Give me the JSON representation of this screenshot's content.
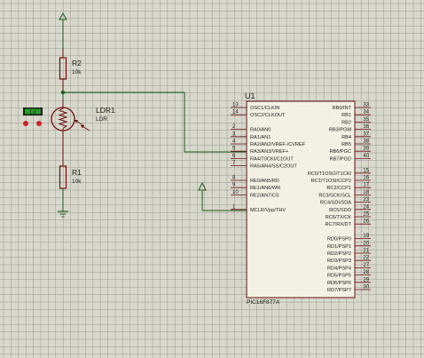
{
  "schematic": {
    "r2": {
      "ref": "R2",
      "value": "10k"
    },
    "r1": {
      "ref": "R1",
      "value": "10k"
    },
    "ldr": {
      "ref": "LDR1",
      "value": "LDR",
      "reading": "1.0"
    },
    "mcu": {
      "ref": "U1",
      "part": "PIC16F877A",
      "left_pins": [
        {
          "num": "13",
          "name": "OSC1/CLKIN"
        },
        {
          "num": "14",
          "name": "OSC2/CLKOUT"
        },
        {
          "num": "2",
          "name": "RA0/AN0"
        },
        {
          "num": "3",
          "name": "RA1/AN1"
        },
        {
          "num": "4",
          "name": "RA2/AN2/VREF-/CVREF"
        },
        {
          "num": "5",
          "name": "RA3/AN3/VREF+"
        },
        {
          "num": "6",
          "name": "RA4/T0CKI/C1OUT"
        },
        {
          "num": "7",
          "name": "RA5/AN4/SS/C2OUT"
        },
        {
          "num": "8",
          "name": "RE0/AN5/RD"
        },
        {
          "num": "9",
          "name": "RE1/AN6/WR"
        },
        {
          "num": "10",
          "name": "RE2/AN7/CS"
        },
        {
          "num": "1",
          "name": "MCLR/Vpp/THV"
        }
      ],
      "right_pins_b": [
        {
          "num": "33",
          "name": "RB0/INT"
        },
        {
          "num": "34",
          "name": "RB1"
        },
        {
          "num": "35",
          "name": "RB2"
        },
        {
          "num": "36",
          "name": "RB3/PGM"
        },
        {
          "num": "37",
          "name": "RB4"
        },
        {
          "num": "38",
          "name": "RB5"
        },
        {
          "num": "39",
          "name": "RB6/PGC"
        },
        {
          "num": "40",
          "name": "RB7/PGD"
        }
      ],
      "right_pins_c": [
        {
          "num": "15",
          "name": "RC0/T1OSO/T1CKI"
        },
        {
          "num": "16",
          "name": "RC1/T1OSI/CCP2"
        },
        {
          "num": "17",
          "name": "RC2/CCP1"
        },
        {
          "num": "18",
          "name": "RC3/SCK/SCL"
        },
        {
          "num": "23",
          "name": "RC4/SDI/SDA"
        },
        {
          "num": "24",
          "name": "RC5/SDO"
        },
        {
          "num": "25",
          "name": "RC6/TX/CK"
        },
        {
          "num": "26",
          "name": "RC7/RX/DT"
        }
      ],
      "right_pins_d": [
        {
          "num": "19",
          "name": "RD0/PSP0"
        },
        {
          "num": "20",
          "name": "RD1/PSP1"
        },
        {
          "num": "21",
          "name": "RD2/PSP2"
        },
        {
          "num": "22",
          "name": "RD3/PSP3"
        },
        {
          "num": "27",
          "name": "RD4/PSP4"
        },
        {
          "num": "28",
          "name": "RD5/PSP5"
        },
        {
          "num": "29",
          "name": "RD6/PSP6"
        },
        {
          "num": "30",
          "name": "RD7/PSP7"
        }
      ]
    }
  },
  "colors": {
    "background": "#d9d8cc",
    "grid": "#9a9a90",
    "wire": "#1f5a1f",
    "component": "#6b1010",
    "chip_fill": "#f2f1e4",
    "ldr_display": "#24a024",
    "ldr_button": "#cc2222"
  }
}
